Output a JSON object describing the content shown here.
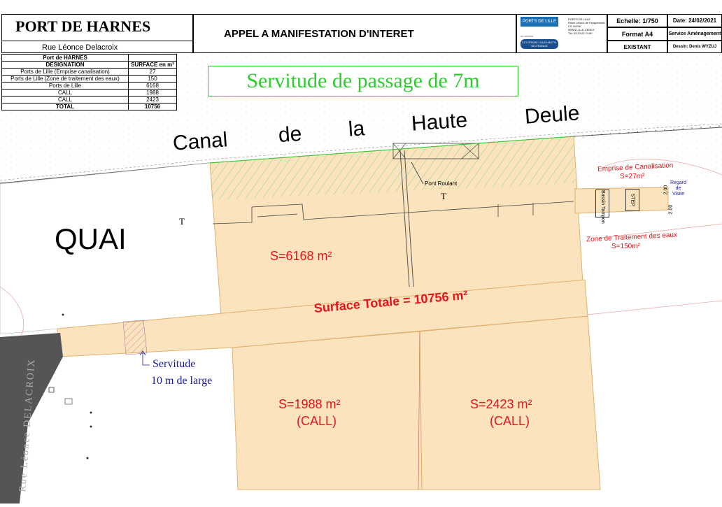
{
  "header": {
    "port_title": "PORT DE HARNES",
    "street": "Rue Léonce Delacroix",
    "main_title": "APPEL A MANIFESTATION D'INTERET",
    "logo_ports": "PORTS DE LILLE",
    "logo_cci": "CCI GRAND LILLE HAUTS-DE-FRANCE",
    "logo_cci_small": "un service",
    "address": [
      "PORTS DE LILLE",
      "Place Leroux de Fauquemont",
      "CS 41296",
      "59014 LILLE CEDEX",
      "Tél: 03.20.22.73.80"
    ],
    "echelle": "Echelle: 1/750",
    "date": "Date: 24/02/2021",
    "format": "Format A4",
    "service": "Service Aménagement",
    "existant": "EXISTANT",
    "dessin": "Dessin: Denis WYZUJ"
  },
  "table": {
    "title": "Port de HARNES",
    "col_designation": "DESIGNATION",
    "col_surface": "SURFACE en m²",
    "rows": [
      {
        "designation": "Ports de Lille (Emprise canalisation)",
        "surface": "27"
      },
      {
        "designation": "Ports de Lille (Zone de traitement des eaux)",
        "surface": "150"
      },
      {
        "designation": "Ports de Lille",
        "surface": "6168"
      },
      {
        "designation": "CALL",
        "surface": "1988"
      },
      {
        "designation": "CALL",
        "surface": "2423"
      }
    ],
    "total_label": "TOTAL",
    "total_value": "10756"
  },
  "map": {
    "servitude_passage": "Servitude de passage de 7m",
    "canal_words": [
      "Canal",
      "de",
      "la",
      "Haute",
      "Deule"
    ],
    "quai": "QUAI",
    "pont_roulant": "Pont Roulant",
    "area_6168": "S=6168 m²",
    "surface_totale": "Surface Totale = 10756 m²",
    "area_1988": "S=1988 m²",
    "area_1988_owner": "(CALL)",
    "area_2423": "S=2423 m²",
    "area_2423_owner": "(CALL)",
    "servitude_10m_1": "Servitude",
    "servitude_10m_2": "10 m de large",
    "emprise_canalisation": "Emprise de Canalisation",
    "emprise_surface": "S=27m²",
    "zone_traitement": "Zone de Traitement des eaux",
    "zone_surface": "S=150m²",
    "bassin_tampon": "Bassin Tampon",
    "step": "STEP",
    "regard_visite": [
      "Regard",
      "de",
      "Visite"
    ],
    "dim_200a": "2.00",
    "dim_200b": "2.00",
    "road_name": "Rue Léonce DELACROIX",
    "symbol_t": "T"
  },
  "colors": {
    "parcel_fill": "#fbe3bd",
    "parcel_stroke": "#e0b070",
    "green": "#2ecc2e",
    "red": "#e8131b",
    "blue": "#1a1aa6"
  }
}
